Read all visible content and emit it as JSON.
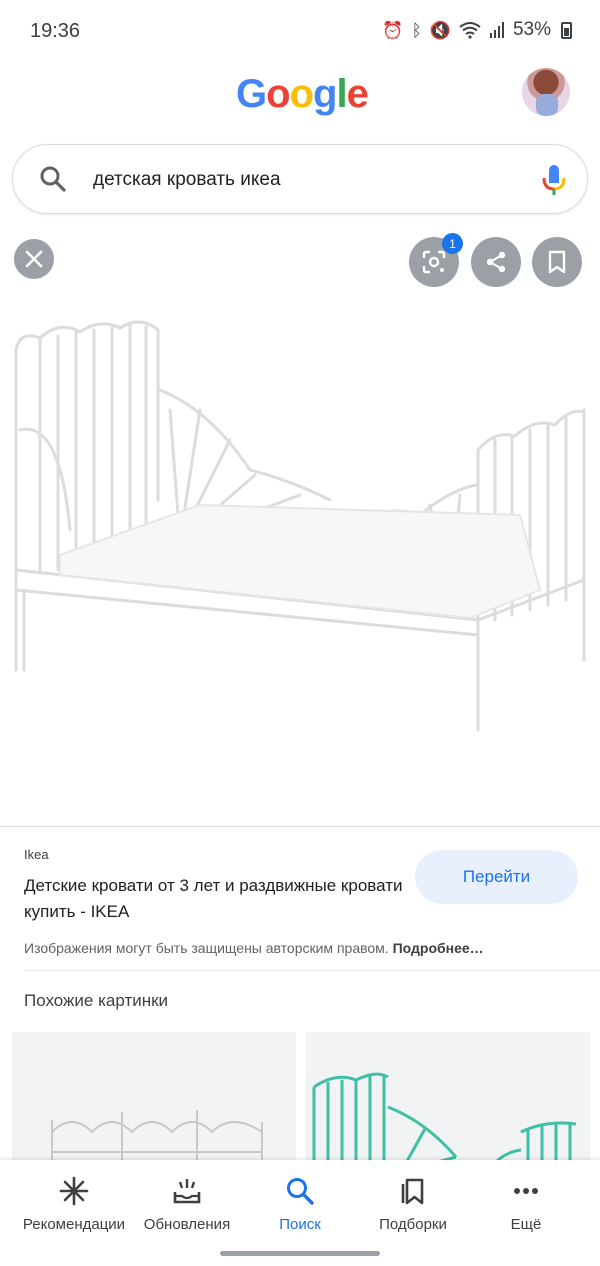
{
  "status_bar": {
    "time": "19:36",
    "battery": "53%",
    "icons": [
      "alarm-icon",
      "bluetooth-icon",
      "mute-icon",
      "wifi-icon",
      "signal-icon",
      "battery-icon"
    ]
  },
  "header": {
    "logo_letters": [
      {
        "char": "G",
        "color": "#4285F4"
      },
      {
        "char": "o",
        "color": "#EA4335"
      },
      {
        "char": "o",
        "color": "#FBBC05"
      },
      {
        "char": "g",
        "color": "#4285F4"
      },
      {
        "char": "l",
        "color": "#34A853"
      },
      {
        "char": "e",
        "color": "#EA4335"
      }
    ],
    "avatar_icon": "avatar"
  },
  "search": {
    "query": "детская кровать икеа"
  },
  "viewer": {
    "lens_badge_count": "1",
    "icons": [
      "close-icon",
      "lens-icon",
      "share-icon",
      "bookmark-icon"
    ]
  },
  "result": {
    "source": "Ikea",
    "title": "Детские кровати от 3 лет и раздвижные кровати купить - IKEA",
    "visit_label": "Перейти",
    "copyright_text": "Изображения могут быть защищены авторским правом.",
    "more_link": "Подробнее…"
  },
  "similar": {
    "heading": "Похожие картинки"
  },
  "bottom_nav": {
    "items": [
      {
        "label": "Рекомендации",
        "icon": "asterisk-icon"
      },
      {
        "label": "Обновления",
        "icon": "updates-icon"
      },
      {
        "label": "Поиск",
        "icon": "search-icon",
        "active": true
      },
      {
        "label": "Подборки",
        "icon": "collections-icon"
      },
      {
        "label": "Ещё",
        "icon": "more-icon"
      }
    ]
  },
  "colors": {
    "accent": "#1a73e8",
    "button_gray": "#9aa0a6",
    "visit_bg": "#e8f0fe"
  }
}
